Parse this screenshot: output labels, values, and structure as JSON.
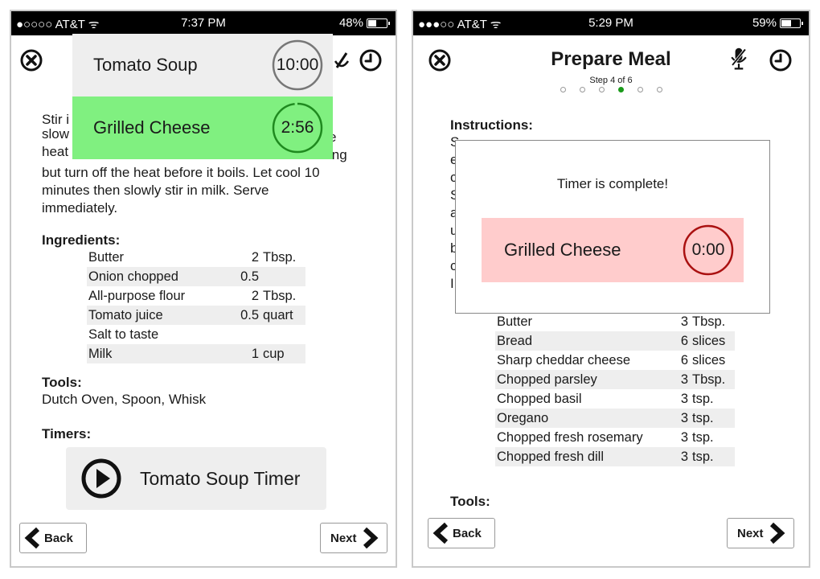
{
  "left": {
    "status": {
      "carrier": "●○○○○ AT&T ᯤ",
      "time": "7:37 PM",
      "battery": "48%",
      "battery_level": 0.48
    },
    "overlay": [
      {
        "name": "Tomato Soup",
        "time": "10:00",
        "progress": 1.0,
        "bg": "#eeeeee",
        "ring": "#777777"
      },
      {
        "name": "Grilled Cheese",
        "time": "2:56",
        "progress": 0.98,
        "bg": "#80f080",
        "ring": "#1f8a1f"
      }
    ],
    "instructions_partial": [
      "Stir i",
      "slow",
      "heat"
    ],
    "instructions_right": [
      "e",
      "ing"
    ],
    "instructions_lines": [
      "but turn off the heat before it boils. Let cool 10",
      "minutes then slowly stir in milk. Serve",
      "immediately."
    ],
    "ingredients_heading": "Ingredients:",
    "ingredients": [
      {
        "name": "Butter",
        "qty": "2",
        "unit": "Tbsp."
      },
      {
        "name": "Onion chopped",
        "qty": "0.5",
        "unit": ""
      },
      {
        "name": "All-purpose flour",
        "qty": "2",
        "unit": "Tbsp."
      },
      {
        "name": "Tomato juice",
        "qty": "0.5",
        "unit": "quart"
      },
      {
        "name": "Salt to taste",
        "qty": "",
        "unit": ""
      },
      {
        "name": "Milk",
        "qty": "1",
        "unit": "cup"
      }
    ],
    "tools_heading": "Tools:",
    "tools": "Dutch Oven, Spoon, Whisk",
    "timers_heading": "Timers:",
    "timer_button": "Tomato Soup Timer",
    "back": "Back",
    "next": "Next"
  },
  "right": {
    "status": {
      "carrier": "●●●○○ AT&T ᯤ",
      "time": "5:29 PM",
      "battery": "59%",
      "battery_level": 0.59
    },
    "title": "Prepare Meal",
    "step_label": "Step 4 of 6",
    "step_current": 4,
    "step_total": 6,
    "instructions_heading": "Instructions:",
    "instructions_fragments": [
      "S",
      "e",
      "c",
      "S",
      "a",
      "u",
      "b",
      "c",
      "I"
    ],
    "dialog": {
      "message": "Timer is complete!",
      "name": "Grilled Cheese",
      "time": "0:00"
    },
    "ingredients": [
      {
        "name": "Butter",
        "qty": "3",
        "unit": "Tbsp."
      },
      {
        "name": "Bread",
        "qty": "6",
        "unit": "slices"
      },
      {
        "name": "Sharp cheddar cheese",
        "qty": "6",
        "unit": "slices"
      },
      {
        "name": "Chopped parsley",
        "qty": "3",
        "unit": "Tbsp."
      },
      {
        "name": "Chopped basil",
        "qty": "3",
        "unit": "tsp."
      },
      {
        "name": "Oregano",
        "qty": "3",
        "unit": "tsp."
      },
      {
        "name": "Chopped fresh rosemary",
        "qty": "3",
        "unit": "tsp."
      },
      {
        "name": "Chopped fresh dill",
        "qty": "3",
        "unit": "tsp."
      }
    ],
    "tools_heading": "Tools:",
    "back": "Back",
    "next": "Next"
  },
  "icons": [
    "close-circle-icon",
    "microphone-off-icon",
    "clock-icon",
    "play-icon",
    "chevron-left-icon",
    "chevron-right-icon",
    "wifi-icon",
    "battery-icon"
  ]
}
